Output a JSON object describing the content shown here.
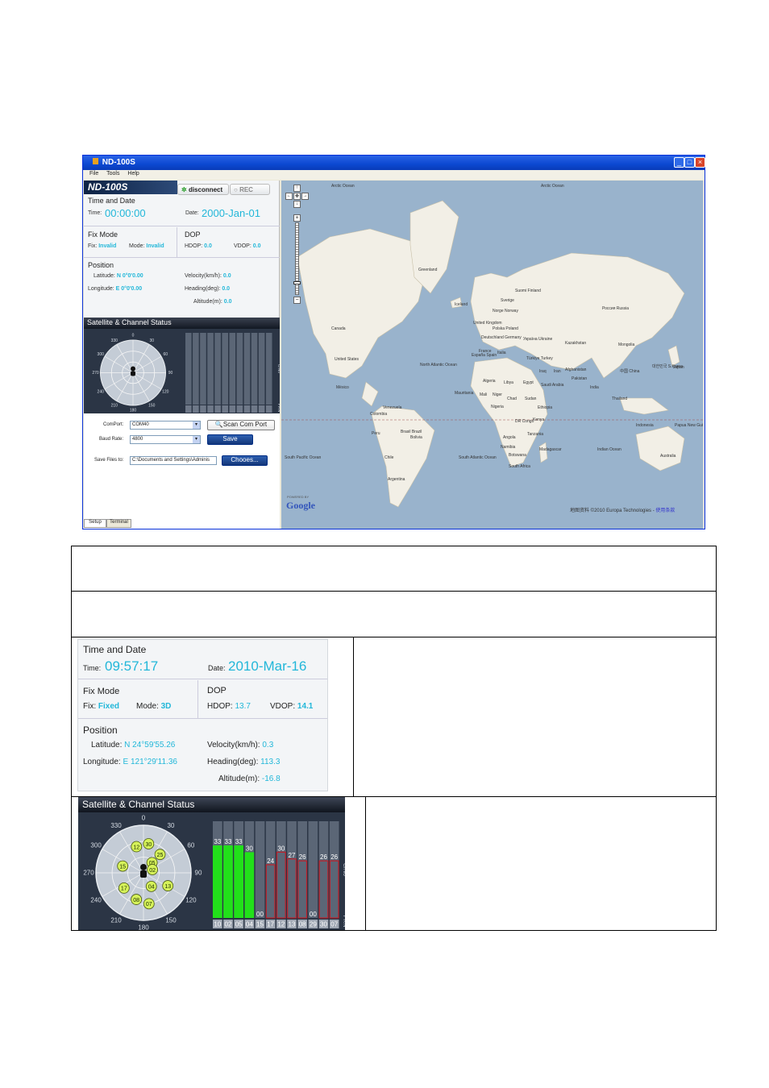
{
  "window": {
    "title": "ND-100S",
    "menu": [
      "File",
      "Tools",
      "Help"
    ],
    "logo": "ND-100S",
    "disconnect_label": "disconnect",
    "rec_label": "REC",
    "tabs": [
      "Setup",
      "Terminal"
    ]
  },
  "small": {
    "time_date_title": "Time and Date",
    "time_label": "Time:",
    "time_value": "00:00:00",
    "date_label": "Date:",
    "date_value": "2000-Jan-01",
    "fix_title": "Fix Mode",
    "fix_label": "Fix:",
    "fix_value": "Invalid",
    "mode_label": "Mode:",
    "mode_value": "Invalid",
    "dop_title": "DOP",
    "hdop_label": "HDOP:",
    "hdop_value": "0.0",
    "vdop_label": "VDOP:",
    "vdop_value": "0.0",
    "position_title": "Position",
    "lat_label": "Latitude:",
    "lat_value": "N 0°0'0.00",
    "lon_label": "Longitude:",
    "lon_value": "E 0°0'0.00",
    "vel_label": "Velocity(km/h):",
    "vel_value": "0.0",
    "head_label": "Heading(deg):",
    "head_value": "0.0",
    "alt_label": "Altitude(m):",
    "alt_value": "0.0",
    "sat_title": "Satellite & Channel Status",
    "comport_label": "ComPort:",
    "comport_value": "COM40",
    "scan_label": "Scan Com Port",
    "baud_label": "Baud Rate:",
    "baud_value": "4800",
    "save_label": "Save",
    "savefiles_label": "Save Files to:",
    "savefiles_value": "C:\\Documents and Settings\\Adminis",
    "choose_label": "Chooes..."
  },
  "map": {
    "labels": [
      "Arctic Ocean",
      "Arctic Ocean",
      "Greenland",
      "Iceland",
      "Suomi Finland",
      "Sverige",
      "Norge Norway",
      "United Kingdom",
      "Россия Russia",
      "Polska Poland",
      "Deutschland Germany",
      "Україна Ukraine",
      "France",
      "Kazakhstan",
      "Mongolia",
      "España Spain",
      "Italia",
      "Türkiye Turkey",
      "Canada",
      "United States",
      "México",
      "North Atlantic Ocean",
      "Iraq",
      "Iran",
      "Afghanistan",
      "Pakistan",
      "中国 China",
      "대한민국 S.Korea",
      "Japan",
      "India",
      "Thailand",
      "Algeria",
      "Libya",
      "Egypt",
      "Saudi Arabia",
      "Mauritania",
      "Mali",
      "Niger",
      "Chad",
      "Sudan",
      "Ethiopia",
      "Nigeria",
      "Kenya",
      "DR Congo",
      "Tanzania",
      "Angola",
      "Namibia",
      "Botswana",
      "Madagascar",
      "South Africa",
      "Venezuela",
      "Colombia",
      "Peru",
      "Brasil Brazil",
      "Bolivia",
      "Chile",
      "Argentina",
      "South Pacific Ocean",
      "South Atlantic Ocean",
      "Indian Ocean",
      "Indonesia",
      "Papua New Guinea",
      "Australia"
    ],
    "google": "Google",
    "powered": "POWERED BY",
    "copyright": "地图资料 ©2010 Europa Technologies -",
    "terms": "使用条款"
  },
  "big": {
    "time_date_title": "Time and Date",
    "time_label": "Time:",
    "time_value": "09:57:17",
    "date_label": "Date:",
    "date_value": "2010-Mar-16",
    "fix_title": "Fix Mode",
    "fix_label": "Fix:",
    "fix_value": "Fixed",
    "mode_label": "Mode:",
    "mode_value": "3D",
    "dop_title": "DOP",
    "hdop_label": "HDOP:",
    "hdop_value": "13.7",
    "vdop_label": "VDOP:",
    "vdop_value": "14.1",
    "position_title": "Position",
    "lat_label": "Latitude:",
    "lat_value": "N 24°59'55.26",
    "lon_label": "Longitude:",
    "lon_value": "E 121°29'11.36",
    "vel_label": "Velocity(km/h):",
    "vel_value": "0.3",
    "head_label": "Heading(deg):",
    "head_value": "113.3",
    "alt_label": "Altitude(m):",
    "alt_value": "-16.8",
    "sat_title": "Satellite & Channel Status"
  },
  "compass": {
    "angles": [
      "0",
      "30",
      "60",
      "90",
      "120",
      "150",
      "180",
      "210",
      "240",
      "270",
      "300",
      "330"
    ],
    "cno_label": "C/N0",
    "prn_label": "PRN"
  },
  "sky_sats": [
    "12",
    "30",
    "25",
    "15",
    "05",
    "02",
    "17",
    "04",
    "13",
    "08",
    "07"
  ],
  "channels": [
    {
      "prn": "10",
      "cno": "33",
      "state": "used",
      "level": 0.75
    },
    {
      "prn": "02",
      "cno": "33",
      "state": "used",
      "level": 0.75
    },
    {
      "prn": "05",
      "cno": "33",
      "state": "used",
      "level": 0.75
    },
    {
      "prn": "04",
      "cno": "30",
      "state": "used",
      "level": 0.68
    },
    {
      "prn": "15",
      "cno": "00",
      "state": "none",
      "level": 0
    },
    {
      "prn": "17",
      "cno": "24",
      "state": "tracked",
      "level": 0.55
    },
    {
      "prn": "12",
      "cno": "30",
      "state": "tracked",
      "level": 0.68
    },
    {
      "prn": "13",
      "cno": "27",
      "state": "tracked",
      "level": 0.61
    },
    {
      "prn": "08",
      "cno": "26",
      "state": "tracked",
      "level": 0.59
    },
    {
      "prn": "29",
      "cno": "00",
      "state": "none",
      "level": 0
    },
    {
      "prn": "30",
      "cno": "26",
      "state": "tracked",
      "level": 0.59
    },
    {
      "prn": "07",
      "cno": "26",
      "state": "tracked",
      "level": 0.59
    }
  ],
  "colors": {
    "cyan": "#22b7d9",
    "used": "#22e01a",
    "tracked": "#c0202a",
    "sky_sat": "#d6f25a"
  }
}
